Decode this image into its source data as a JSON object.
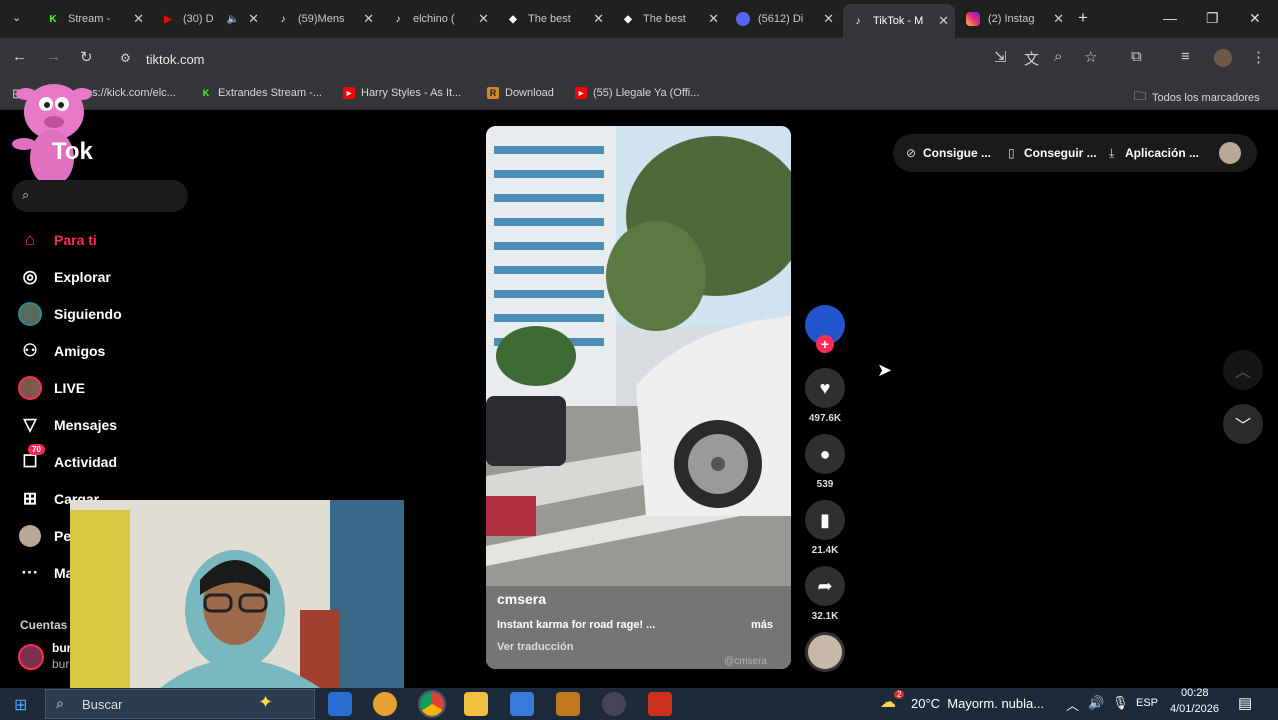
{
  "browser": {
    "tabs": [
      {
        "title": "Stream - ",
        "favicon_color": "#53fc18",
        "favicon_glyph": "K"
      },
      {
        "title": "(30) D",
        "favicon_color": "#ff0000",
        "favicon_glyph": "▶"
      },
      {
        "title": "(59)Mens",
        "favicon_color": "#111111",
        "favicon_glyph": "♪"
      },
      {
        "title": "elchino (",
        "favicon_color": "#111111",
        "favicon_glyph": "♪"
      },
      {
        "title": "The best",
        "favicon_color": "#ffffff",
        "favicon_glyph": "◆"
      },
      {
        "title": "The best",
        "favicon_color": "#ffffff",
        "favicon_glyph": "◆"
      },
      {
        "title": "(5612) Di",
        "favicon_color": "#5865f2",
        "favicon_glyph": "●"
      },
      {
        "title": "TikTok - M",
        "favicon_color": "#111111",
        "favicon_glyph": "♪",
        "active": true
      },
      {
        "title": "(2) Instag",
        "favicon_color": "#d6249f",
        "favicon_glyph": "◎"
      }
    ],
    "url": "tiktok.com",
    "bookmarks": [
      {
        "label": "ps://kick.com/elc...",
        "icon_color": ""
      },
      {
        "label": "Extrandes Stream -...",
        "icon_color": "#53fc18"
      },
      {
        "label": "Harry Styles - As It...",
        "icon_color": "#ff0000"
      },
      {
        "label": "Download",
        "icon_color": "#d08a2a"
      },
      {
        "label": "(55) Llegale Ya (Offi...",
        "icon_color": "#ff0000"
      }
    ],
    "all_bookmarks_label": "Todos los marcadores"
  },
  "tiktok": {
    "logo_text": "Tok",
    "nav": [
      {
        "label": "Para ti",
        "icon": "home-icon",
        "active": true
      },
      {
        "label": "Explorar",
        "icon": "compass-icon"
      },
      {
        "label": "Siguiendo",
        "icon": "avatar-icon"
      },
      {
        "label": "Amigos",
        "icon": "friends-icon"
      },
      {
        "label": "LIVE",
        "icon": "live-icon"
      },
      {
        "label": "Mensajes",
        "icon": "send-icon"
      },
      {
        "label": "Actividad",
        "icon": "inbox-icon",
        "badge": "70"
      },
      {
        "label": "Cargar",
        "icon": "upload-icon"
      },
      {
        "label": "Pe",
        "icon": "profile-icon"
      },
      {
        "label": "Ma",
        "icon": "more-icon"
      }
    ],
    "accounts_heading": "Cuentas",
    "accounts": [
      "bur",
      "bur"
    ],
    "video": {
      "author": "cmsera",
      "description": "Instant karma for road rage! ...",
      "more_label": "más",
      "translate_label": "Ver traducción",
      "watermark": "@cmsera"
    },
    "actions": [
      {
        "name": "like",
        "count": "497.6K"
      },
      {
        "name": "comment",
        "count": "539"
      },
      {
        "name": "bookmark",
        "count": "21.4K"
      },
      {
        "name": "share",
        "count": "32.1K"
      }
    ],
    "top_buttons": [
      "Consigue ...",
      "Conseguir ...",
      "Aplicación ..."
    ]
  },
  "taskbar": {
    "search_placeholder": "Buscar",
    "weather": "20°C  Mayorm. nubla...",
    "weather_badge": "2",
    "lang": "ESP",
    "time": "00:28",
    "date": "4/01/2026"
  },
  "colors": {
    "tiktok_red": "#fe2c55",
    "chrome_dark": "#35363a",
    "taskbar": "#1c2a3a"
  }
}
